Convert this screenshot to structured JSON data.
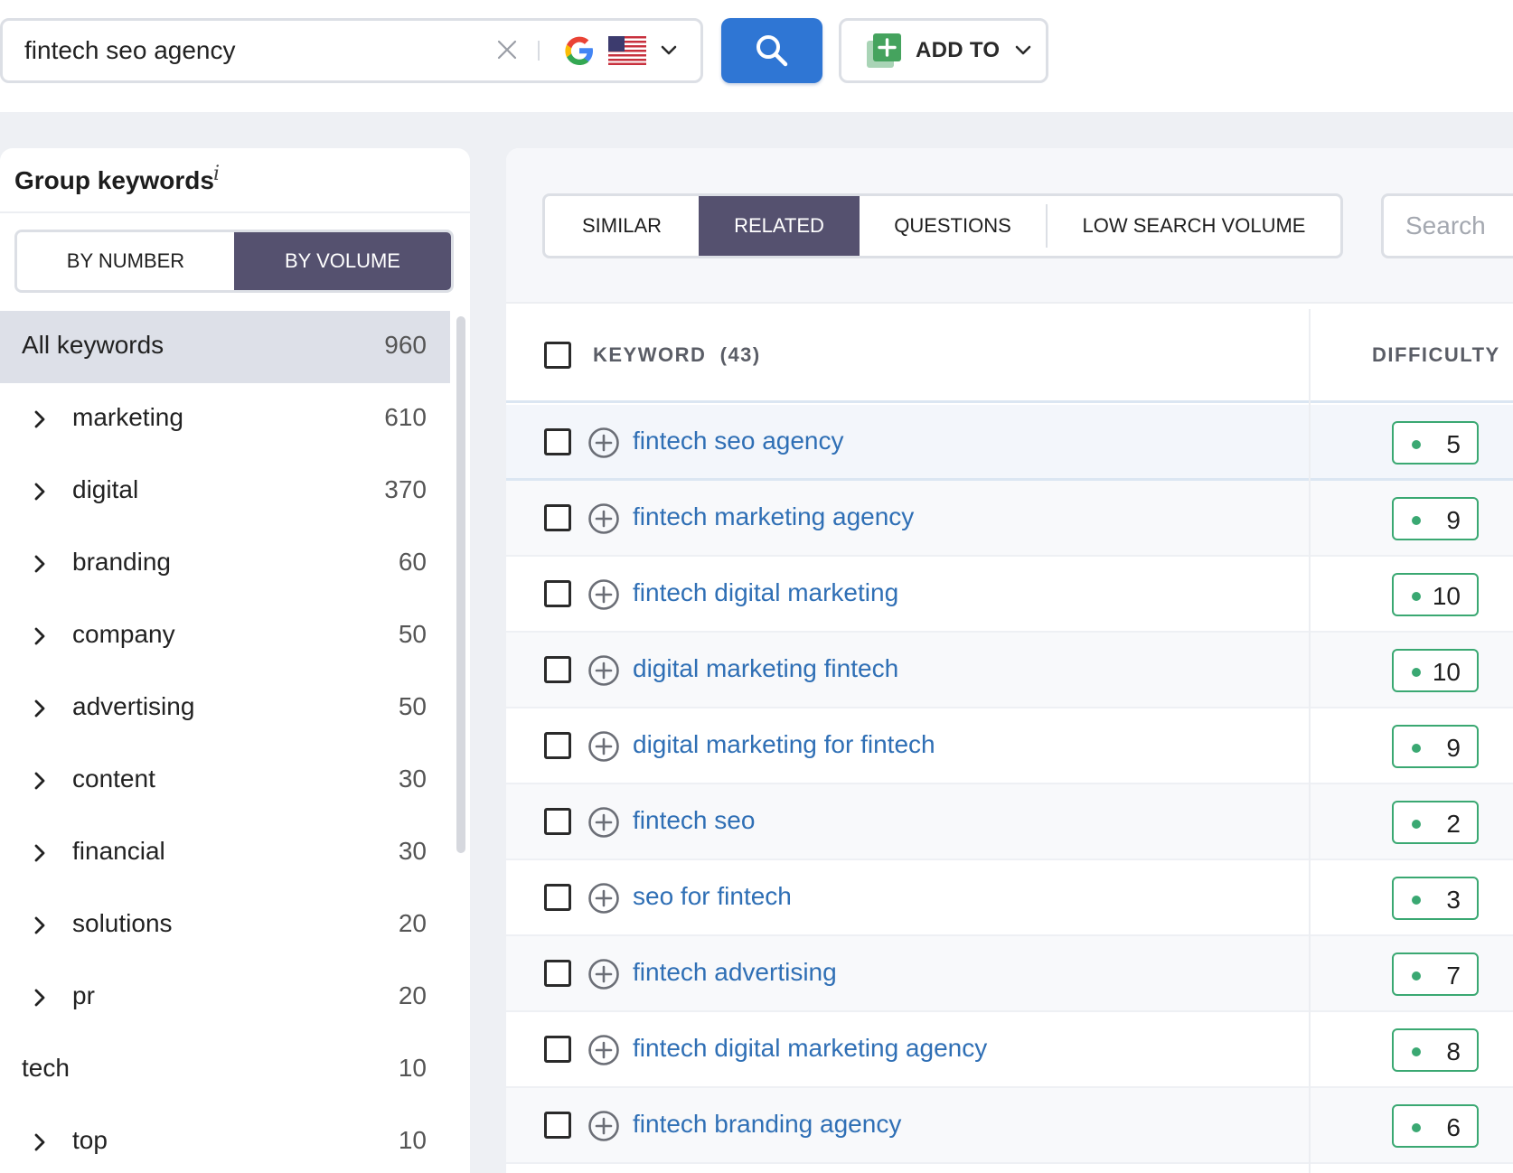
{
  "search": {
    "query": "fintech seo agency",
    "placeholder": "",
    "engine_icon": "google-icon",
    "region_icon": "us-flag-icon"
  },
  "toolbar": {
    "add_to_label": "ADD TO"
  },
  "group_panel": {
    "title": "Group keywords",
    "info": "i",
    "modes": [
      {
        "label": "BY NUMBER",
        "active": false
      },
      {
        "label": "BY VOLUME",
        "active": true
      }
    ],
    "items": [
      {
        "name": "All keywords",
        "count": "960",
        "expandable": false,
        "active": true
      },
      {
        "name": "marketing",
        "count": "610",
        "expandable": true
      },
      {
        "name": "digital",
        "count": "370",
        "expandable": true
      },
      {
        "name": "branding",
        "count": "60",
        "expandable": true
      },
      {
        "name": "company",
        "count": "50",
        "expandable": true
      },
      {
        "name": "advertising",
        "count": "50",
        "expandable": true
      },
      {
        "name": "content",
        "count": "30",
        "expandable": true
      },
      {
        "name": "financial",
        "count": "30",
        "expandable": true
      },
      {
        "name": "solutions",
        "count": "20",
        "expandable": true
      },
      {
        "name": "pr",
        "count": "20",
        "expandable": true
      },
      {
        "name": "tech",
        "count": "10",
        "expandable": false
      },
      {
        "name": "top",
        "count": "10",
        "expandable": true
      }
    ]
  },
  "tabs": [
    {
      "label": "SIMILAR",
      "active": false
    },
    {
      "label": "RELATED",
      "active": true
    },
    {
      "label": "QUESTIONS",
      "active": false
    },
    {
      "label": "LOW SEARCH VOLUME",
      "active": false
    }
  ],
  "tab_search": {
    "placeholder": "Search"
  },
  "table": {
    "keyword_header": "KEYWORD",
    "keyword_count": "(43)",
    "difficulty_header": "DIFFICULTY",
    "rows": [
      {
        "keyword": "fintech seo agency",
        "difficulty": "5"
      },
      {
        "keyword": "fintech marketing agency",
        "difficulty": "9"
      },
      {
        "keyword": "fintech digital marketing",
        "difficulty": "10"
      },
      {
        "keyword": "digital marketing fintech",
        "difficulty": "10"
      },
      {
        "keyword": "digital marketing for fintech",
        "difficulty": "9"
      },
      {
        "keyword": "fintech seo",
        "difficulty": "2"
      },
      {
        "keyword": "seo for fintech",
        "difficulty": "3"
      },
      {
        "keyword": "fintech advertising",
        "difficulty": "7"
      },
      {
        "keyword": "fintech digital marketing agency",
        "difficulty": "8"
      },
      {
        "keyword": "fintech branding agency",
        "difficulty": "6"
      }
    ]
  },
  "colors": {
    "accent_blue": "#2f76d4",
    "active_tab": "#55516f",
    "link": "#2f6fb5",
    "difficulty_easy": "#3aa872"
  }
}
